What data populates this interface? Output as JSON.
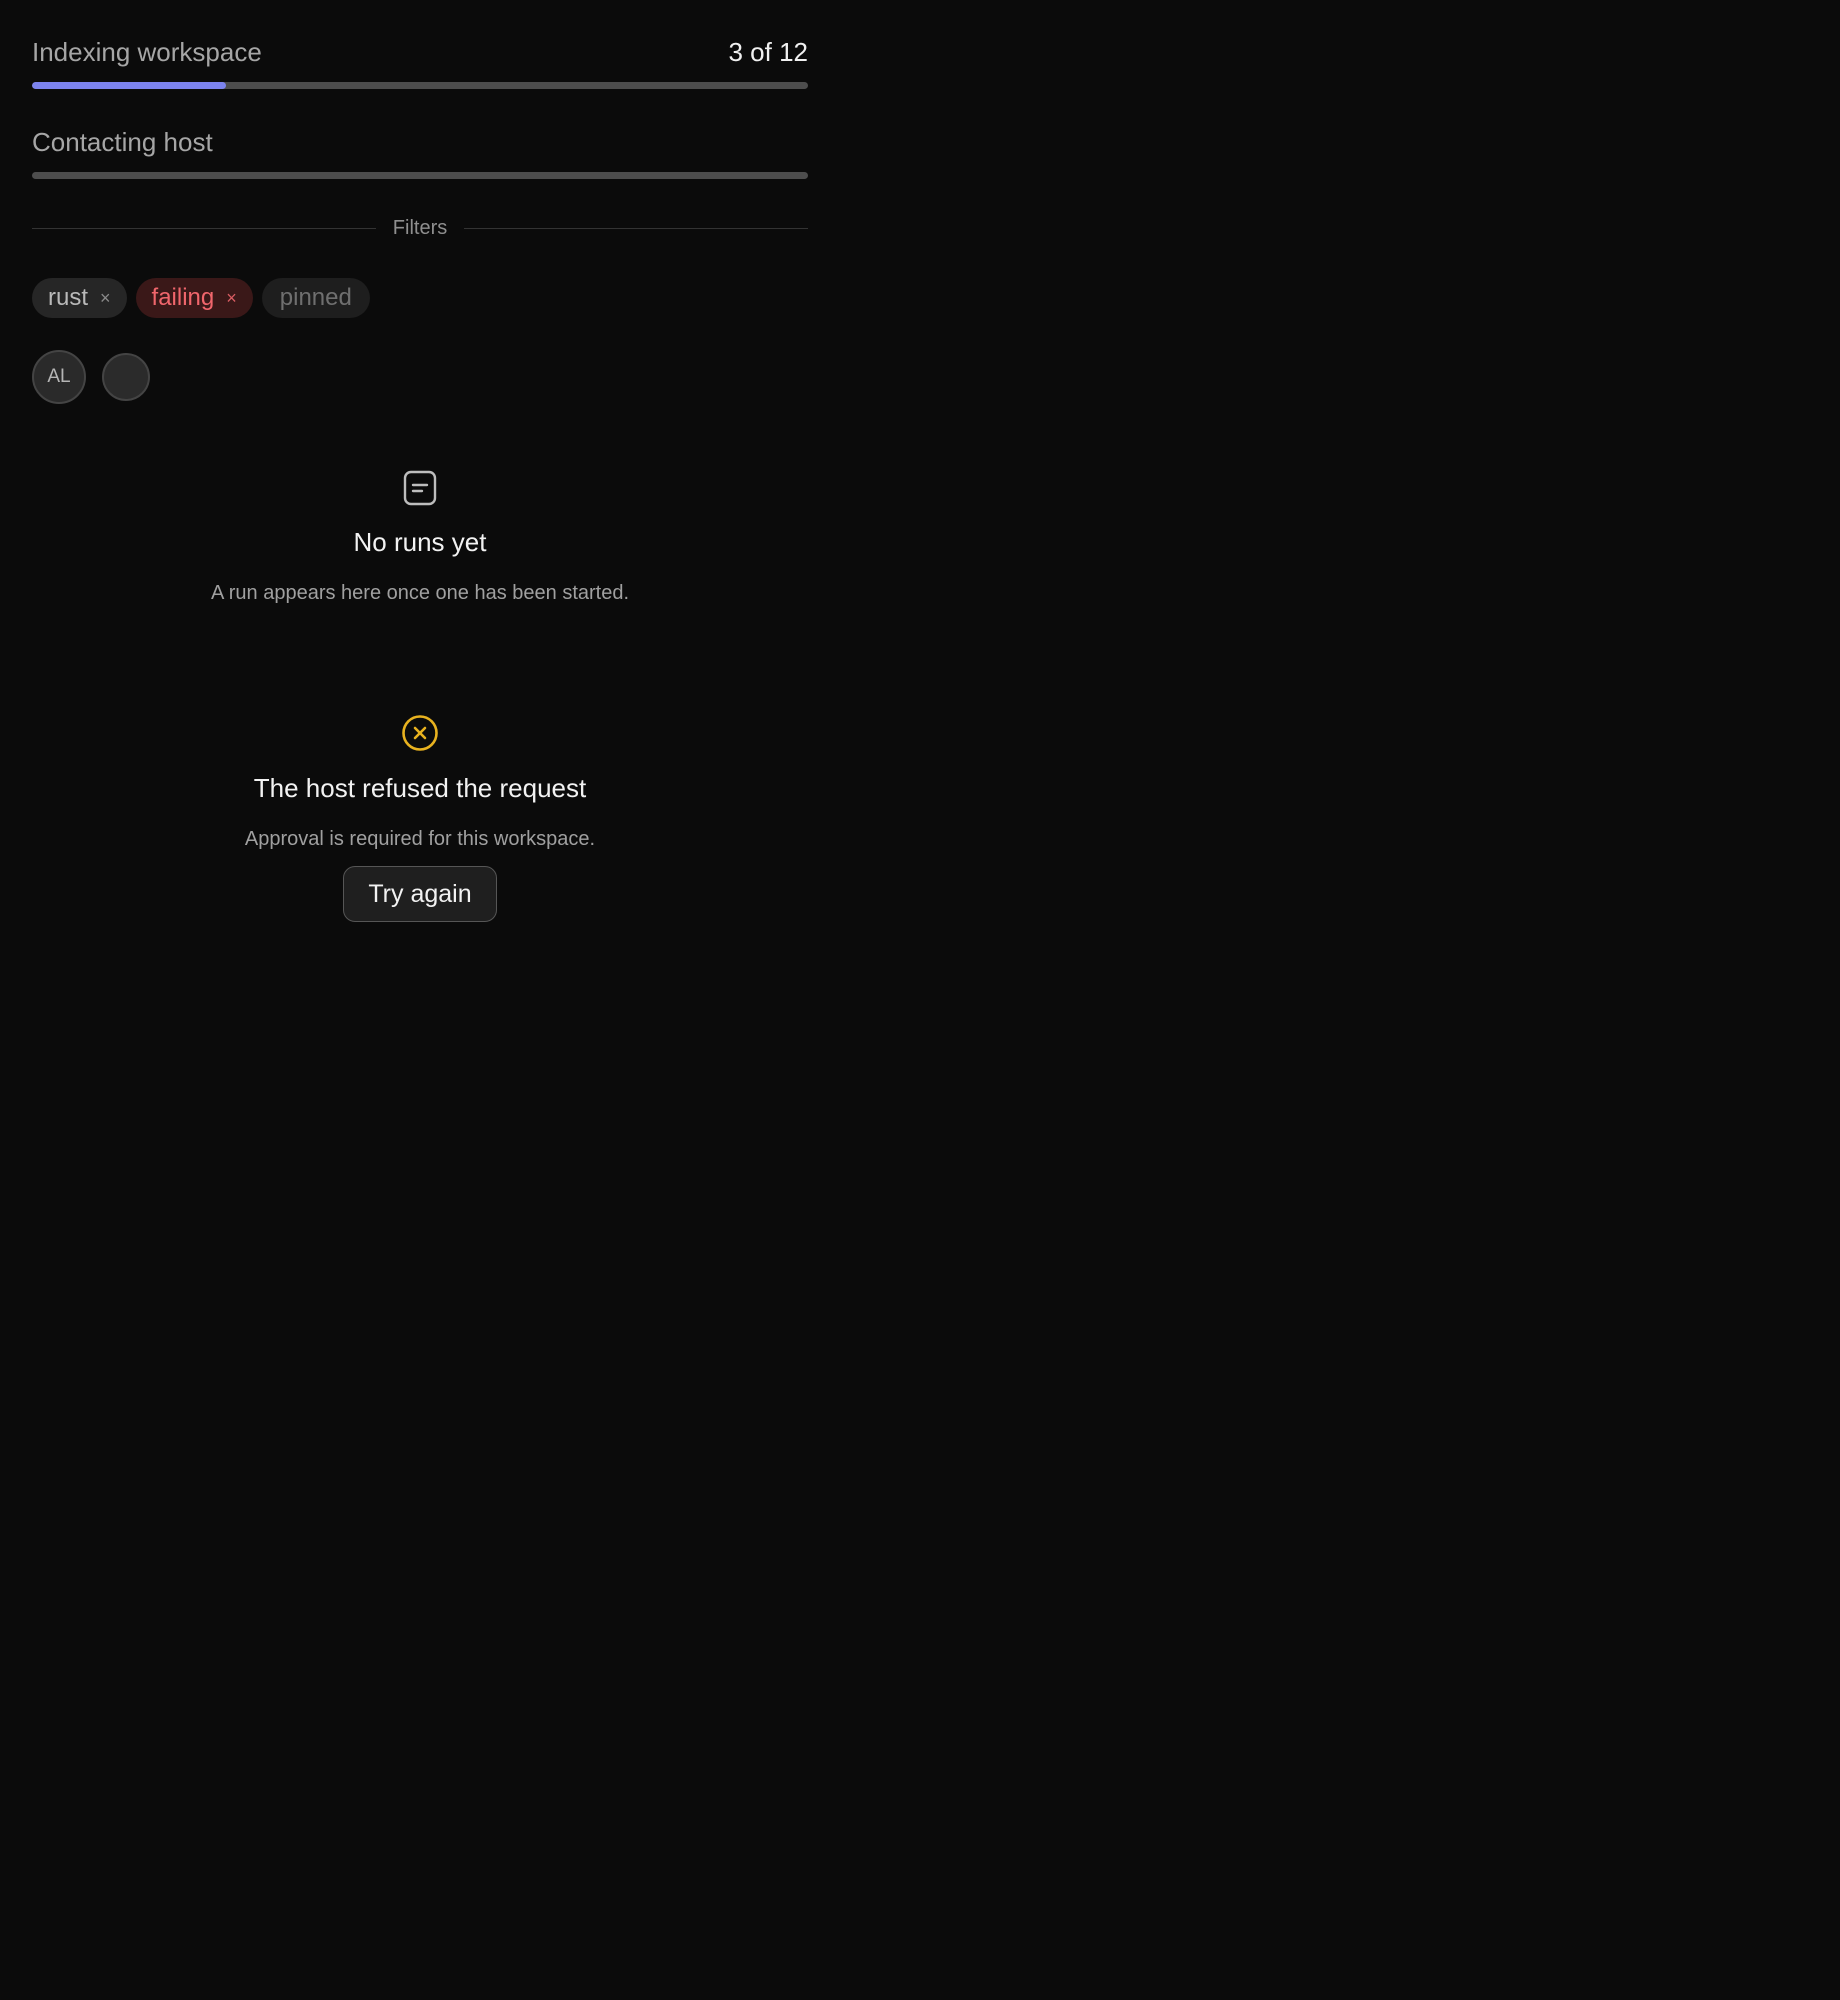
{
  "progress_indexing": {
    "label": "Indexing workspace",
    "count_text": "3 of 12",
    "value": 3,
    "total": 12,
    "color": "#7c83ee"
  },
  "progress_host": {
    "label": "Contacting host"
  },
  "filters": {
    "label": "Filters",
    "chips": [
      {
        "label": "rust",
        "removable": true
      },
      {
        "label": "failing",
        "removable": true,
        "tone": "danger"
      },
      {
        "label": "pinned",
        "removable": false
      }
    ],
    "remove_glyph": "×"
  },
  "avatars": [
    {
      "initials": "AL"
    },
    {
      "initials": ""
    }
  ],
  "empty_state": {
    "icon": "document-icon",
    "title": "No runs yet",
    "description": "A run appears here once one has been started."
  },
  "error_state": {
    "icon": "x-circle-icon",
    "icon_color": "#e8b21f",
    "title": "The host refused the request",
    "description": "Approval is required for this workspace.",
    "retry_label": "Try again"
  }
}
